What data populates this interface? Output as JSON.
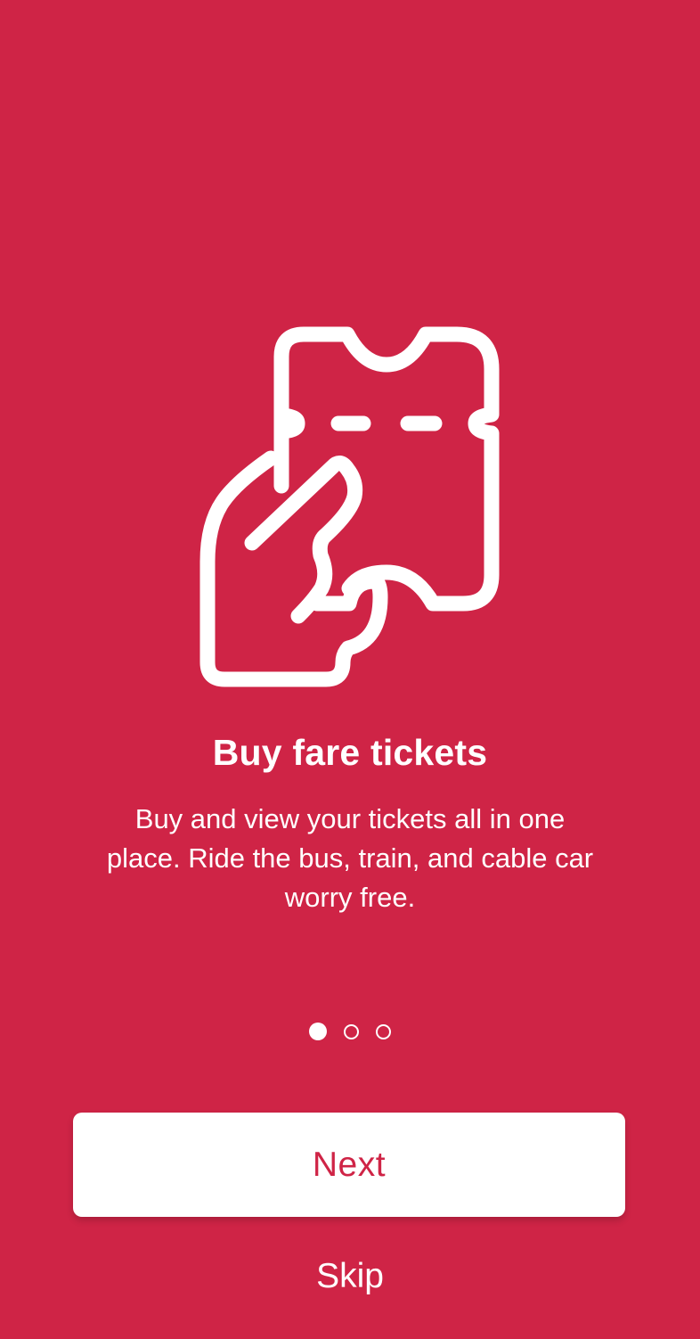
{
  "theme": {
    "background": "#CF2446",
    "foreground": "#FFFFFF",
    "button_text": "#CF2446"
  },
  "onboarding": {
    "illustration_icon": "hand-holding-ticket-icon",
    "title": "Buy fare tickets",
    "description": "Buy and view your tickets all in one place. Ride the bus, train, and cable car worry free.",
    "page_indicator": {
      "total": 3,
      "current": 1
    },
    "next_label": "Next",
    "skip_label": "Skip"
  }
}
